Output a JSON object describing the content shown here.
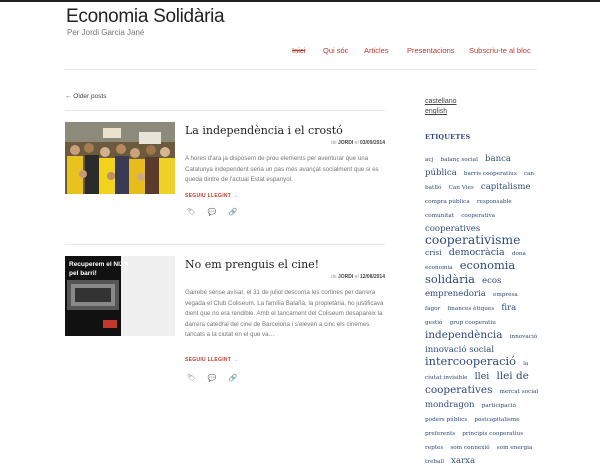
{
  "site": {
    "title": "Economia Solidària",
    "tagline": "Per Jordi Garcia Jané"
  },
  "nav": [
    "Inici",
    "Qui sóc",
    "Articles",
    "Presentacions",
    "Subscriu-te al bloc"
  ],
  "older_posts": "← Older posts",
  "posts": [
    {
      "title": "La independència i el crostó",
      "meta_prefix": "de",
      "author": "JORDI",
      "meta_mid": "el",
      "date": "03/09/2014",
      "excerpt": "A hores d'ara ja disposem de prou elements per aventurar que una Catalunya independent seria un pas més avançat socialment que si es queda dintre de l'actual Estat espanyol.",
      "more": "SEGUIU LLEGINT →"
    },
    {
      "title": "No em prenguis el cine!",
      "meta_prefix": "de",
      "author": "JORDI",
      "meta_mid": "el",
      "date": "12/08/2014",
      "excerpt": "Gairebé sense avisar, el 31 de juliol descorria les cortines per darrera vegada el Club Coliseum. La família Balañà, la propietària, ho justificava dient que no era rendible. Amb el tancament del Coliseum desapareix la darrera catedral del cine de Barcelona i s'eleven a cinc els cinemes tancats a la ciutat en el que va…",
      "more": "SEGUIU LLEGINT →",
      "poster": {
        "line1": "Recuperem el NIZA",
        "line2": "pel barri!"
      }
    }
  ],
  "sidebar": {
    "languages": [
      "castellano",
      "english"
    ],
    "tags_heading": "ETIQUETES",
    "tags": [
      {
        "t": "acj",
        "s": 6
      },
      {
        "t": "balanç social",
        "s": 6
      },
      {
        "t": "banca pública",
        "s": 9
      },
      {
        "t": "barris cooperatius",
        "s": 6
      },
      {
        "t": "can batlló",
        "s": 6
      },
      {
        "t": "Can Vies",
        "s": 6
      },
      {
        "t": "capitalisme",
        "s": 9
      },
      {
        "t": "compra pública",
        "s": 6
      },
      {
        "t": "responsable",
        "s": 6
      },
      {
        "t": "comunitat",
        "s": 6
      },
      {
        "t": "cooperativa",
        "s": 6
      },
      {
        "t": "cooperatives",
        "s": 9
      },
      {
        "t": "cooperativisme",
        "s": 13
      },
      {
        "t": "crisi",
        "s": 8
      },
      {
        "t": "democràcia",
        "s": 10
      },
      {
        "t": "dona",
        "s": 6
      },
      {
        "t": "economia",
        "s": 6
      },
      {
        "t": "economia solidària",
        "s": 12
      },
      {
        "t": "ecos",
        "s": 9
      },
      {
        "t": "emprenedoria",
        "s": 9
      },
      {
        "t": "empresa",
        "s": 6
      },
      {
        "t": "fagor",
        "s": 6
      },
      {
        "t": "finances ètiques",
        "s": 6
      },
      {
        "t": "fira",
        "s": 9
      },
      {
        "t": "gestió",
        "s": 6
      },
      {
        "t": "grup cooperatiu",
        "s": 6
      },
      {
        "t": "independència",
        "s": 11
      },
      {
        "t": "innovació",
        "s": 6
      },
      {
        "t": "innovació social",
        "s": 9
      },
      {
        "t": "intercooperació",
        "s": 12
      },
      {
        "t": "la ciutat invisible",
        "s": 6
      },
      {
        "t": "llei",
        "s": 10
      },
      {
        "t": "llei de cooperatives",
        "s": 11
      },
      {
        "t": "mercat social",
        "s": 6
      },
      {
        "t": "mondragon",
        "s": 9
      },
      {
        "t": "participació",
        "s": 6
      },
      {
        "t": "poders públics",
        "s": 6
      },
      {
        "t": "postcapitalisme",
        "s": 6
      },
      {
        "t": "preferents",
        "s": 6
      },
      {
        "t": "principis cooperatius",
        "s": 6
      },
      {
        "t": "reptes",
        "s": 6
      },
      {
        "t": "som connexió",
        "s": 6
      },
      {
        "t": "som energia",
        "s": 6
      },
      {
        "t": "treball",
        "s": 6
      },
      {
        "t": "xarxa",
        "s": 9
      }
    ]
  },
  "icon_names": [
    "tag-icon",
    "comment-icon",
    "link-icon"
  ]
}
